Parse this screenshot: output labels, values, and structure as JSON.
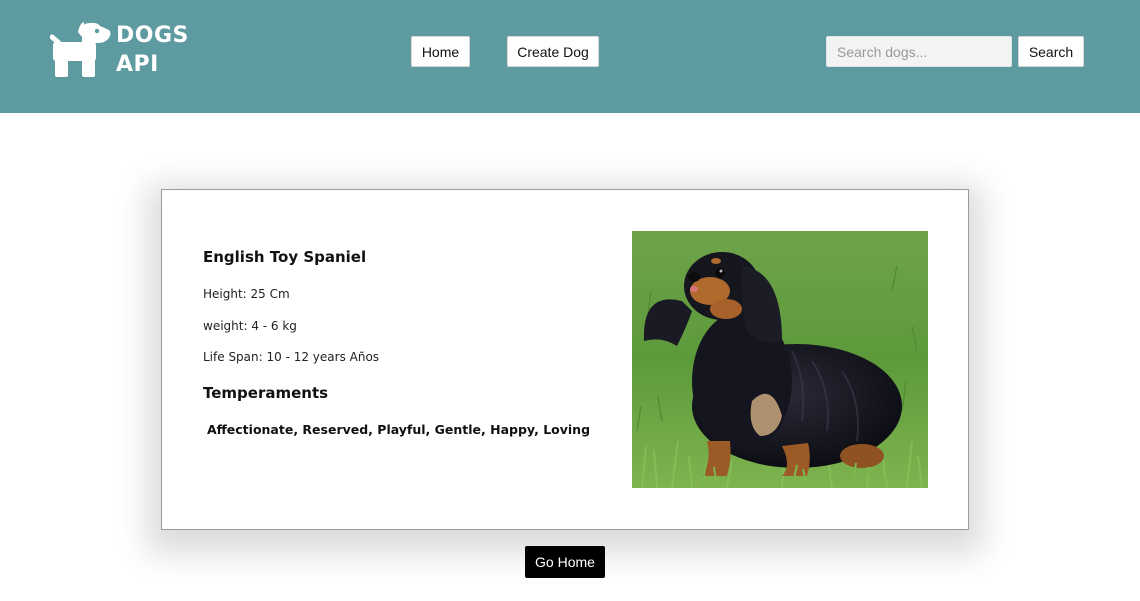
{
  "header": {
    "logo_line1": "DOGS",
    "logo_line2": "API",
    "logo_icon": "dog-icon",
    "background_color": "#5e9ba0"
  },
  "nav": {
    "home_label": "Home",
    "create_label": "Create Dog"
  },
  "search": {
    "placeholder": "Search dogs...",
    "value": "",
    "button_label": "Search"
  },
  "dog": {
    "name": "English Toy Spaniel",
    "height": "Height: 25 Cm",
    "weight": "weight: 4 - 6 kg",
    "life_span": "Life Span: 10 - 12 years Años",
    "temperaments_title": "Temperaments",
    "temperaments": "Affectionate, Reserved, Playful, Gentle, Happy, Loving"
  },
  "footer": {
    "go_home_label": "Go Home"
  }
}
